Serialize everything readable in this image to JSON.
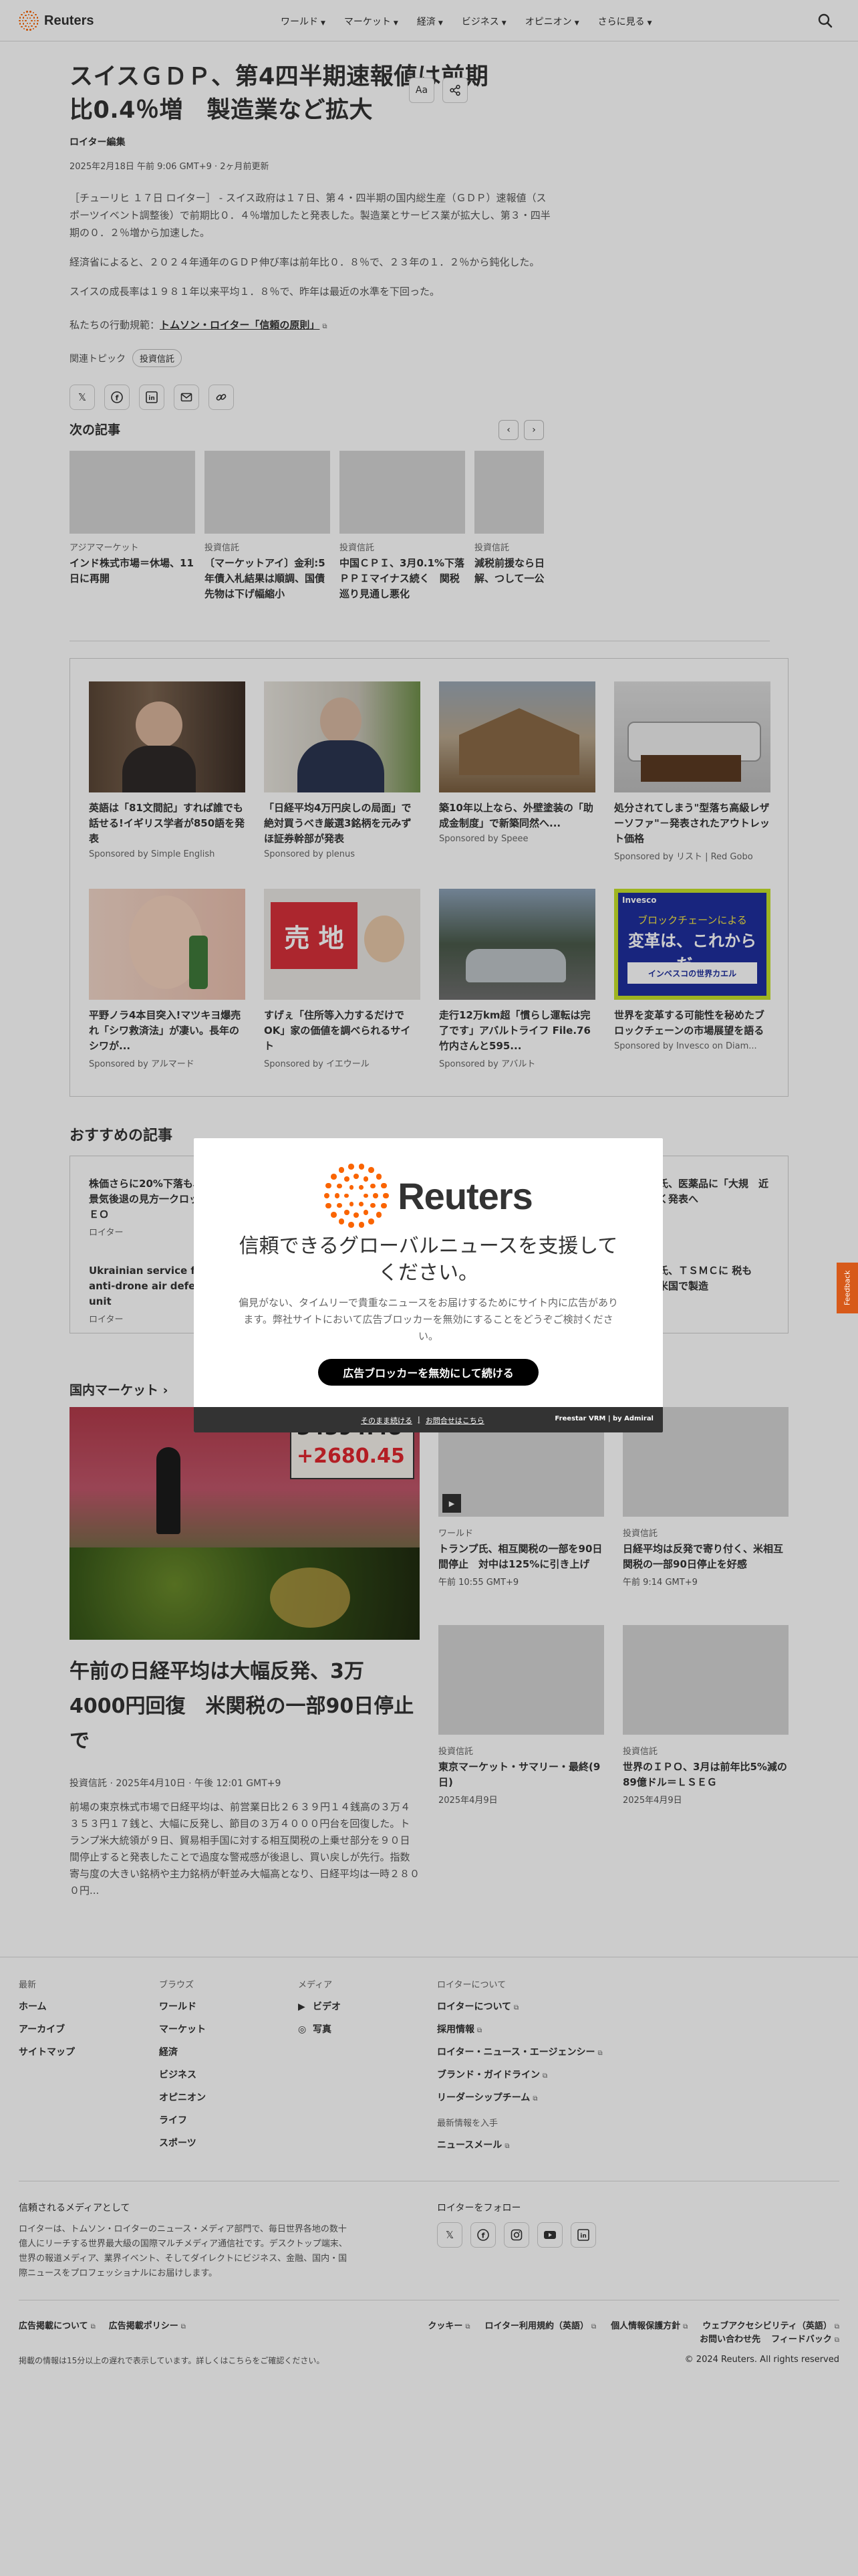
{
  "nav": {
    "brand": "Reuters",
    "items": [
      "ワールド",
      "マーケット",
      "経済",
      "ビジネス",
      "オピニオン",
      "さらに見る"
    ]
  },
  "article": {
    "headline_line1": "スイスＧＤＰ、第4四半期速報値は前期",
    "headline_line2": "比0.4％増　製造業など拡大",
    "byline": "ロイター編集",
    "dateline": "2025年2月18日 午前 9:06 GMT+9 · 2ヶ月前更新",
    "text_size_label": "Aa",
    "paragraphs": [
      "［チューリヒ １７日 ロイター］ - スイス政府は１７日、第４・四半期の国内総生産（ＧＤＰ）速報値（スポーツイベント調整後）で前期比０．４％増加したと発表した。製造業とサービス業が拡大し、第３・四半期の０．２％増から加速した。",
      "経済省によると、２０２４年通年のＧＤＰ伸び率は前年比０．８％で、２３年の１．２％から鈍化した。",
      "スイスの成長率は１９８１年以来平均１．８％で、昨年は最近の水準を下回った。"
    ],
    "principles_prefix": "私たちの行動規範：",
    "principles_link": "トムソン・ロイター「信頼の原則」",
    "topics_label": "関連トピック",
    "topic_chip": "投資信託"
  },
  "next": {
    "title": "次の記事",
    "cards": [
      {
        "category": "アジアマーケット",
        "headline": "インド株式市場＝休場、11日に再開"
      },
      {
        "category": "投資信託",
        "headline": "〔マーケットアイ〕金利:5年債入札結果は順調、国債先物は下げ幅縮小"
      },
      {
        "category": "投資信託",
        "headline": "中国ＣＰＩ、3月0.1%下落　ＰＰＩマイナス続く　関税巡り見通し悪化"
      },
      {
        "category": "投資信託",
        "headline": "減税前援なら日一定の理解、つして一公明代表"
      }
    ]
  },
  "sponsored": [
    {
      "title": "英語は「81文間記」すれば誰でも話せる!イギリス学者が850語を発表",
      "by": "Sponsored by Simple English"
    },
    {
      "title": "「日経平均4万円戻しの局面」で絶対買うべき厳選3銘柄を元みずほ証券幹部が発表",
      "by": "Sponsored by plenus"
    },
    {
      "title": "築10年以上なら、外壁塗装の「助成金制度」で新築同然へ...",
      "by": "Sponsored by Speee"
    },
    {
      "title": "処分されてしまう\"型落ち高級レザーソファ\"－発表されたアウトレット価格",
      "by": "Sponsored by リスト | Red Gobo"
    },
    {
      "title": "平野ノラ4本目突入!マツキヨ爆売れ「シワ救済法」が凄い。長年のシワが...",
      "by": "Sponsored by アルマード"
    },
    {
      "title": "すげぇ「住所等入力するだけでOK」家の価値を調べられるサイト",
      "by": "Sponsored by イエウール"
    },
    {
      "title": "走行12万km超「慣らし運転は完了です」アバルトライフ File.76 竹内さんと595...",
      "by": "Sponsored by アバルト"
    },
    {
      "title": "世界を変革する可能性を秘めたブロックチェーンの市場展望を語る",
      "by": "Sponsored by Invesco on Diam..."
    }
  ],
  "sponsored_images": {
    "sale_sign": "売 地",
    "invesco_brand": "Invesco",
    "invesco_line1": "ブロックチェーンによる",
    "invesco_line2": "変革は、これからだ。",
    "invesco_fund": "インベスコの世界カエル"
  },
  "recommended": {
    "title": "おすすめの記事",
    "items": [
      {
        "headline": "株価さらに20%下落も、米景気後退の見方一クロックＣＥＯ",
        "source": "ロイター"
      },
      {
        "headline": "Ukrainian service from anti-drone air defence unit",
        "source": "ロイター"
      },
      {
        "headline": "氏、医薬品に「大規　近く発表へ",
        "source": ""
      },
      {
        "headline": "氏、ＴＳＭＣに 税も　米国で製造",
        "source": ""
      }
    ]
  },
  "markets": {
    "title": "国内マーケット",
    "hero_board_line1": "34394.48",
    "hero_board_line2": "+2680.45",
    "hero_headline": "午前の日経平均は大幅反発、3万4000円回復　米関税の一部90日停止で",
    "hero_meta": "投資信託 · 2025年4月10日 · 午後 12:01 GMT+9",
    "hero_body": "前場の東京株式市場で日経平均は、前営業日比２６３９円１４銭高の３万４３５３円１７銭と、大幅に反発し、節目の３万４０００円台を回復した。トランプ米大統領が９日、貿易相手国に対する相互関税の上乗せ部分を９０日間停止すると発表したことで過度な警戒感が後退し、買い戻しが先行。指数寄与度の大きい銘柄や主力銘柄が軒並み大幅高となり、日経平均は一時２８００円...",
    "cards": [
      {
        "category": "ワールド",
        "headline": "トランプ氏、相互関税の一部を90日間停止　対中は125%に引き上げ",
        "time": "午前 10:55 GMT+9",
        "video": true
      },
      {
        "category": "投資信託",
        "headline": "日経平均は反発で寄り付く、米相互関税の一部90日停止を好感",
        "time": "午前 9:14 GMT+9",
        "video": false
      },
      {
        "category": "投資信託",
        "headline": "東京マーケット・サマリー・最終(9日)",
        "time": "2025年4月9日",
        "video": false
      },
      {
        "category": "投資信託",
        "headline": "世界のＩＰＯ、3月は前年比5%減の89億ドル＝ＬＳＥＧ",
        "time": "2025年4月9日",
        "video": false
      }
    ]
  },
  "footer": {
    "latest": {
      "heading": "最新",
      "items": [
        "ホーム",
        "アーカイブ",
        "サイトマップ"
      ]
    },
    "browse": {
      "heading": "ブラウズ",
      "items": [
        "ワールド",
        "マーケット",
        "経済",
        "ビジネス",
        "オピニオン",
        "ライフ",
        "スポーツ"
      ]
    },
    "media": {
      "heading": "メディア",
      "items": [
        "ビデオ",
        "写真"
      ]
    },
    "about": {
      "heading": "ロイターについて",
      "items": [
        "ロイターについて",
        "採用情報",
        "ロイター・ニュース・エージェンシー",
        "ブランド・ガイドライン",
        "リーダーシップチーム"
      ]
    },
    "latest_info": {
      "heading": "最新情報を入手",
      "items": [
        "ニュースメール"
      ]
    },
    "trusted_heading": "信頼されるメディアとして",
    "trusted_text": "ロイターは、トムソン・ロイターのニュース・メディア部門で、毎日世界各地の数十億人にリーチする世界最大級の国際マルチメディア通信社です。デスクトップ端末、世界の報道メディア、業界イベント、そしてダイレクトにビジネス、金融、国内・国際ニュースをプロフェッショナルにお届けします。",
    "follow_heading": "ロイターをフォロー",
    "bottom_left": [
      "広告掲載について",
      "広告掲載ポリシー"
    ],
    "bottom_right": [
      "クッキー",
      "ロイター利用規約（英語）",
      "個人情報保護方針",
      "ウェブアクセシビリティ（英語）"
    ],
    "bottom_extra": [
      "お問い合わせ先",
      "フィードバック"
    ],
    "disclaimer": "掲載の情報は15分以上の遅れで表示しています。詳しくはこちらをご確認ください。",
    "copyright": "© 2024 Reuters. All rights reserved"
  },
  "feedback_tab": "Feedback",
  "modal": {
    "brand": "Reuters",
    "headline": "信頼できるグローバルニュースを支援してください。",
    "text": "偏見がない、タイムリーで貴重なニュースをお届けするためにサイト内に広告があります。弊社サイトにおいて広告ブロッカーを無効にすることをどうぞご検討ください。",
    "button": "広告ブロッカーを無効にして続ける",
    "foot_link1": "そのまま続ける",
    "foot_link2": "お問合せはこちら",
    "foot_brand": "Freestar VRM  |  by Admiral"
  },
  "colors": {
    "accent": "#fa6400",
    "feedback": "#d75a1a"
  }
}
